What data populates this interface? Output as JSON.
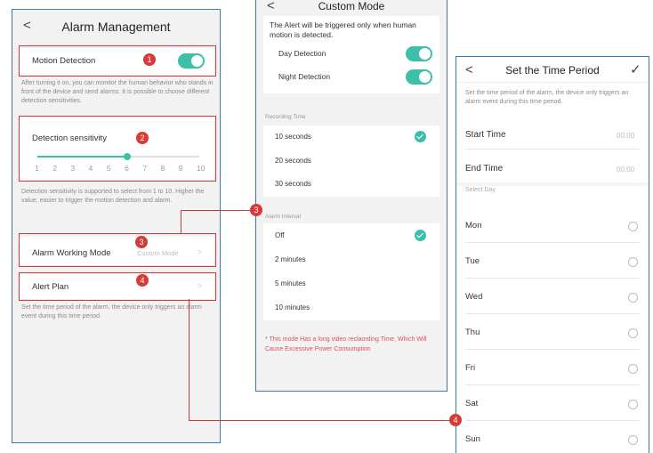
{
  "screen1": {
    "title": "Alarm Management",
    "back": "<",
    "motion_label": "Motion Detection",
    "motion_desc": "After turning it on, you can monitor the human behavior who stands in front of the device and send alarms. It is possible to choose different detection sensitivities.",
    "sensitivity_label": "Detection sensitivity",
    "sensitivity_ticks": [
      "1",
      "2",
      "3",
      "4",
      "5",
      "6",
      "7",
      "8",
      "9",
      "10"
    ],
    "sensitivity_value": 6,
    "sensitivity_desc": "Detection sensitivity is supported to select from 1 to 10. Higher the value, easier to trigger the motion detection and alarm.",
    "working_mode_label": "Alarm Working Mode",
    "working_mode_value": "Custom Mode",
    "alert_plan_label": "Alert Plan",
    "alert_plan_desc": "Set the time period of the alarm, the device only triggers an alarm event during this time period.",
    "badges": [
      "1",
      "2",
      "3",
      "4"
    ]
  },
  "screen2": {
    "title": "Custom Mode",
    "back": "<",
    "alert_desc": "The Alert will be triggered only when human motion is detected.",
    "day_label": "Day Detection",
    "night_label": "Night Detection",
    "recording_header": "Recording Time",
    "recording_options": [
      "10 seconds",
      "20 seconds",
      "30 seconds"
    ],
    "recording_selected": 0,
    "interval_header": "Alarm Interval",
    "interval_options": [
      "Off",
      "2 minutes",
      "5 minutes",
      "10 minutes"
    ],
    "interval_selected": 0,
    "warning": "* This mode Has a long video reclaording Time, Which Will Cause Excessive Power Consumption"
  },
  "screen3": {
    "title": "Set the Time Period",
    "back": "<",
    "confirm": "✓",
    "desc": "Set the time period of the alarm, the device only triggers an alarm event during this time period.",
    "start_label": "Start Time",
    "start_value": "00:00",
    "end_label": "End Time",
    "end_value": "00:00",
    "select_day": "Select Day",
    "days": [
      "Mon",
      "Tue",
      "Wed",
      "Thu",
      "Fri",
      "Sat",
      "Sun"
    ]
  },
  "connectors": {
    "badge3": "3",
    "badge4": "4"
  },
  "colors": {
    "accent": "#3dbfaa",
    "annotation": "#d83a3a",
    "frame": "#3a7ab5"
  }
}
